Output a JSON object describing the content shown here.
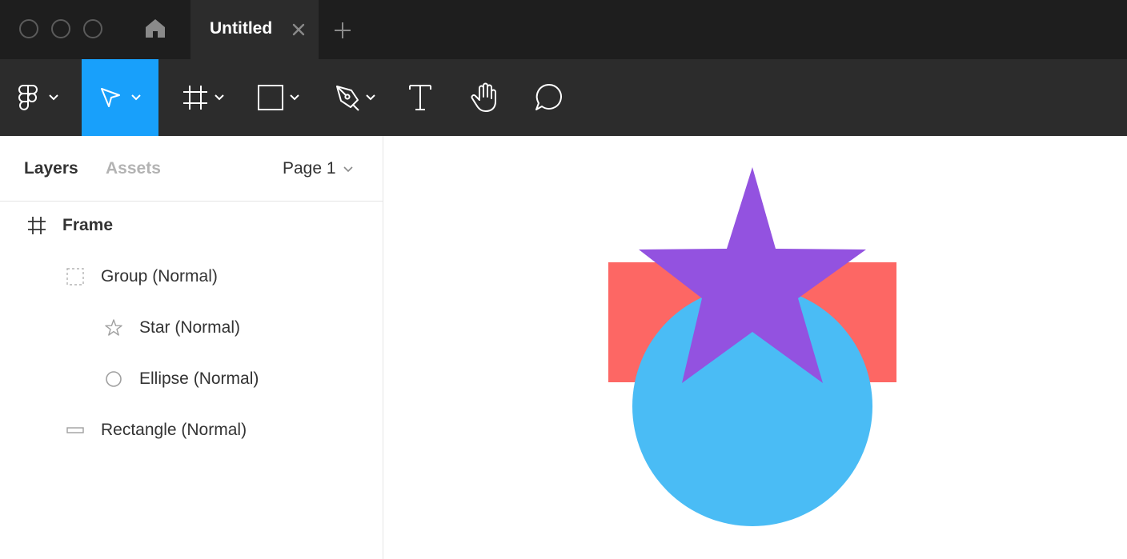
{
  "titlebar": {
    "home_icon": "home-icon",
    "tab": {
      "title": "Untitled",
      "close_icon": "close-icon"
    },
    "add_tab_icon": "plus-icon"
  },
  "toolbar": {
    "tools": [
      {
        "icon": "figma-logo-icon",
        "has_menu": true
      },
      {
        "icon": "move-cursor-icon",
        "has_menu": true,
        "active": true
      },
      {
        "icon": "frame-icon",
        "has_menu": true
      },
      {
        "icon": "rectangle-icon",
        "has_menu": true
      },
      {
        "icon": "pen-icon",
        "has_menu": true
      },
      {
        "icon": "text-icon",
        "has_menu": false
      },
      {
        "icon": "hand-icon",
        "has_menu": false
      },
      {
        "icon": "comment-icon",
        "has_menu": false
      }
    ],
    "active_color": "#18a0fb"
  },
  "left_panel": {
    "tabs": {
      "layers": "Layers",
      "assets": "Assets"
    },
    "page_selector": "Page 1",
    "layers": [
      {
        "name": "Frame",
        "icon": "frame-icon",
        "depth": 0
      },
      {
        "name": "Group (Normal)",
        "icon": "group-icon",
        "depth": 1
      },
      {
        "name": "Star (Normal)",
        "icon": "star-icon",
        "depth": 2
      },
      {
        "name": "Ellipse (Normal)",
        "icon": "ellipse-icon",
        "depth": 2
      },
      {
        "name": "Rectangle (Normal)",
        "icon": "rectangle-icon",
        "depth": 1
      }
    ]
  },
  "canvas": {
    "shapes": [
      {
        "name": "Rectangle",
        "color": "#fd6764"
      },
      {
        "name": "Ellipse",
        "color": "#4abcf5"
      },
      {
        "name": "Star",
        "color": "#9352e0"
      }
    ]
  }
}
